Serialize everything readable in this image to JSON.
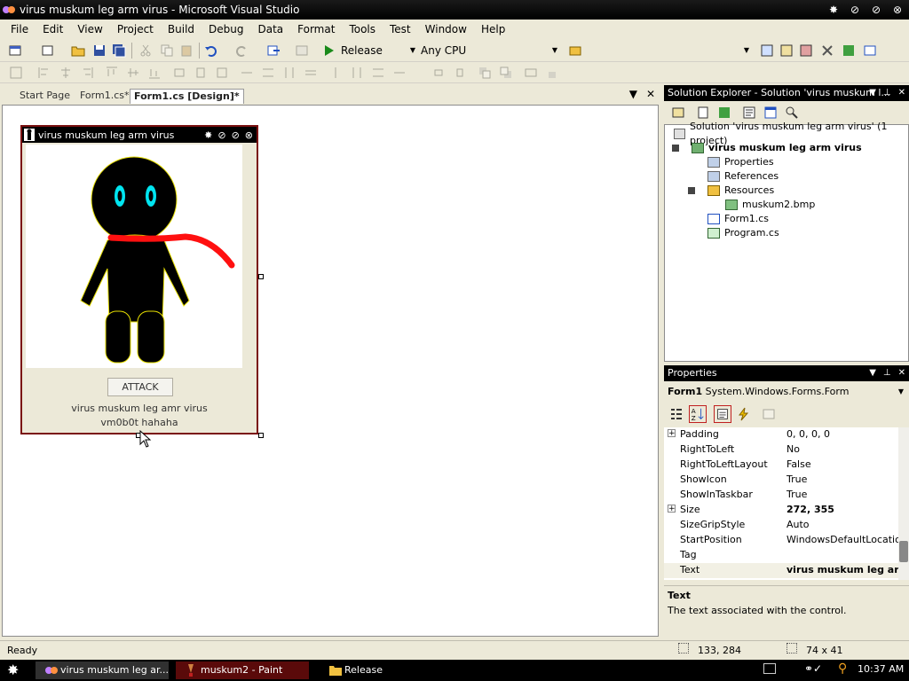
{
  "window": {
    "title": "virus muskum leg arm virus - Microsoft Visual Studio"
  },
  "menu": [
    "File",
    "Edit",
    "View",
    "Project",
    "Build",
    "Debug",
    "Data",
    "Format",
    "Tools",
    "Test",
    "Window",
    "Help"
  ],
  "toolbar": {
    "config": "Release",
    "platform": "Any CPU"
  },
  "doc_tabs": [
    "Start Page",
    "Form1.cs*",
    "Form1.cs [Design]*"
  ],
  "form": {
    "title": "virus muskum leg arm virus",
    "button": "ATTACK",
    "label1": "virus muskum leg amr virus",
    "label2": "vm0b0t hahaha"
  },
  "solution_explorer": {
    "title": "Solution Explorer - Solution 'virus muskum l...",
    "items": [
      "Solution 'virus muskum leg arm virus' (1 project)",
      "virus muskum leg arm virus",
      "Properties",
      "References",
      "Resources",
      "muskum2.bmp",
      "Form1.cs",
      "Program.cs"
    ]
  },
  "properties": {
    "title": "Properties",
    "object_name": "Form1",
    "object_type": "System.Windows.Forms.Form",
    "rows": [
      {
        "name": "Padding",
        "value": "0, 0, 0, 0"
      },
      {
        "name": "RightToLeft",
        "value": "No"
      },
      {
        "name": "RightToLeftLayout",
        "value": "False"
      },
      {
        "name": "ShowIcon",
        "value": "True"
      },
      {
        "name": "ShowInTaskbar",
        "value": "True"
      },
      {
        "name": "Size",
        "value": "272, 355"
      },
      {
        "name": "SizeGripStyle",
        "value": "Auto"
      },
      {
        "name": "StartPosition",
        "value": "WindowsDefaultLocation"
      },
      {
        "name": "Tag",
        "value": ""
      },
      {
        "name": "Text",
        "value": "virus muskum leg arm"
      }
    ],
    "desc_title": "Text",
    "desc_body": "The text associated with the control."
  },
  "status": {
    "text": "Ready",
    "position": "133, 284",
    "size": "74 x 41"
  },
  "taskbar": {
    "items": [
      "virus muskum leg ar...",
      "muskum2 - Paint",
      "Release"
    ],
    "clock": "10:37 AM"
  }
}
